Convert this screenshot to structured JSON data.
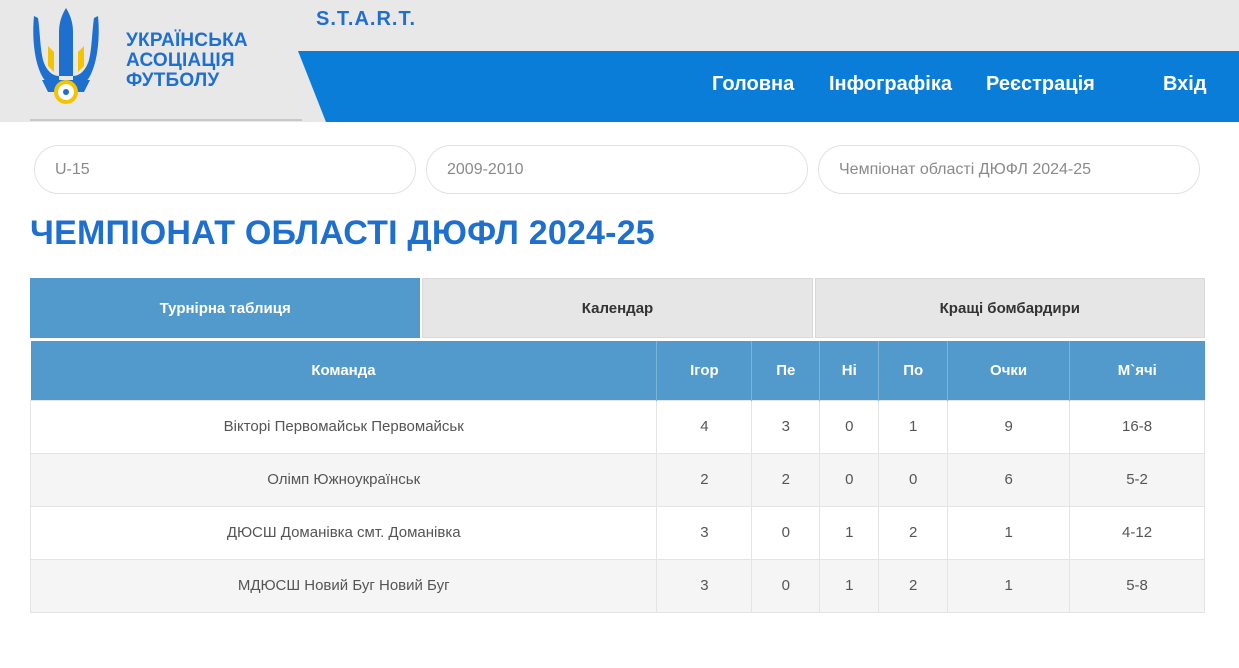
{
  "brand": {
    "line1": "УКРАЇНСЬКА",
    "line2": "АСОЦІАЦІЯ",
    "line3": "ФУТБОЛУ",
    "project": "S.T.A.R.T."
  },
  "nav": {
    "home": "Головна",
    "info": "Інфографіка",
    "register": "Реєстрація",
    "login": "Вхід"
  },
  "filters": {
    "age": "U-15",
    "years": "2009-2010",
    "tournament": "Чемпіонат області ДЮФЛ 2024-25"
  },
  "page_title": "ЧЕМПІОНАТ ОБЛАСТІ ДЮФЛ 2024-25",
  "tabs": [
    {
      "label": "Турнірна таблиця",
      "active": true
    },
    {
      "label": "Календар",
      "active": false
    },
    {
      "label": "Кращі бомбардири",
      "active": false
    }
  ],
  "table": {
    "headers": [
      "Команда",
      "Ігор",
      "Пе",
      "Ні",
      "По",
      "Очки",
      "М`ячі"
    ],
    "rows": [
      [
        "Вікторі Первомайськ Первомайськ",
        "4",
        "3",
        "0",
        "1",
        "9",
        "16-8"
      ],
      [
        "Олімп Южноукраїнськ",
        "2",
        "2",
        "0",
        "0",
        "6",
        "5-2"
      ],
      [
        "ДЮСШ Доманівка смт. Доманівка",
        "3",
        "0",
        "1",
        "2",
        "1",
        "4-12"
      ],
      [
        "МДЮСШ Новий Буг Новий Буг",
        "3",
        "0",
        "1",
        "2",
        "1",
        "5-8"
      ]
    ]
  },
  "colors": {
    "brand_blue": "#1f6fcf",
    "nav_blue": "#0a7dd8",
    "table_blue": "#519acb",
    "logo_yellow": "#f5c400"
  }
}
